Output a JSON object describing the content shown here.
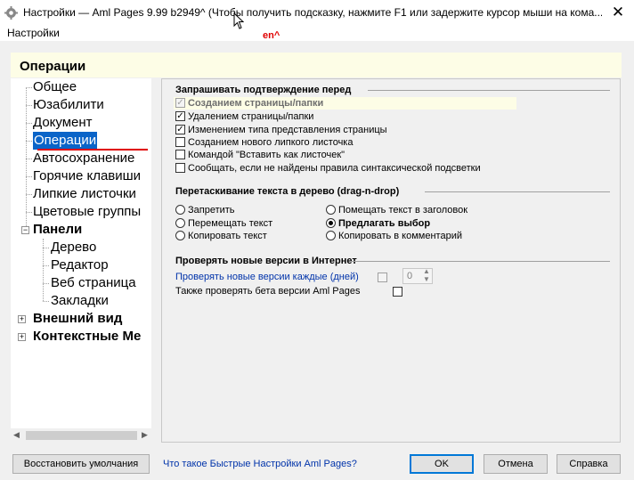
{
  "window": {
    "title": "Настройки  —  Aml Pages 9.99 b2949^ (Чтобы получить подсказку, нажмите F1 или задержите курсор мыши на кома...",
    "close_glyph": "✕",
    "menu": "Настройки",
    "lang_indicator": "en^"
  },
  "header": {
    "title": "Операции"
  },
  "tree": {
    "items": [
      {
        "label": "Общее"
      },
      {
        "label": "Юзабилити"
      },
      {
        "label": "Документ"
      },
      {
        "label": "Операции"
      },
      {
        "label": "Автосохранение"
      },
      {
        "label": "Горячие клавиши"
      },
      {
        "label": "Липкие листочки"
      },
      {
        "label": "Цветовые группы"
      },
      {
        "label": "Панели"
      },
      {
        "label": "Дерево"
      },
      {
        "label": "Редактор"
      },
      {
        "label": "Веб страница"
      },
      {
        "label": "Закладки"
      },
      {
        "label": "Внешний вид"
      },
      {
        "label": "Контекстные Ме"
      }
    ],
    "selected": "Операции"
  },
  "confirm": {
    "title": "Запрашивать подтверждение перед",
    "items": [
      {
        "label": "Созданием страницы/папки",
        "checked": true,
        "disabled": true
      },
      {
        "label": "Удалением страницы/папки",
        "checked": true
      },
      {
        "label": "Изменением типа представления страницы",
        "checked": true
      },
      {
        "label": "Созданием нового липкого листочка",
        "checked": false
      },
      {
        "label": "Командой \"Вставить как листочек\"",
        "checked": false
      },
      {
        "label": "Сообщать, если не найдены правила синтаксической подсветки",
        "checked": false
      }
    ]
  },
  "dnd": {
    "title": "Перетаскивание текста в дерево (drag-n-drop)",
    "left": [
      {
        "label": "Запретить",
        "selected": false
      },
      {
        "label": "Перемещать текст",
        "selected": false
      },
      {
        "label": "Копировать текст",
        "selected": false
      }
    ],
    "right": [
      {
        "label": "Помещать текст в заголовок",
        "selected": false
      },
      {
        "label": "Предлагать выбор",
        "selected": true
      },
      {
        "label": "Копировать в комментарий",
        "selected": false
      }
    ]
  },
  "updates": {
    "title": "Проверять новые версии в Интернет",
    "check_link": "Проверять новые версии каждые (дней)",
    "days_value": "0",
    "beta_label": "Также проверять бета версии Aml Pages"
  },
  "footer": {
    "restore": "Восстановить умолчания",
    "link": "Что такое Быстрые Настройки Aml Pages?",
    "ok": "OK",
    "cancel": "Отмена",
    "help": "Справка"
  },
  "colors": {
    "selection": "#0a64c8",
    "header_bg": "#fdfde6",
    "link": "#0033aa",
    "accent_line": "#e00000"
  }
}
